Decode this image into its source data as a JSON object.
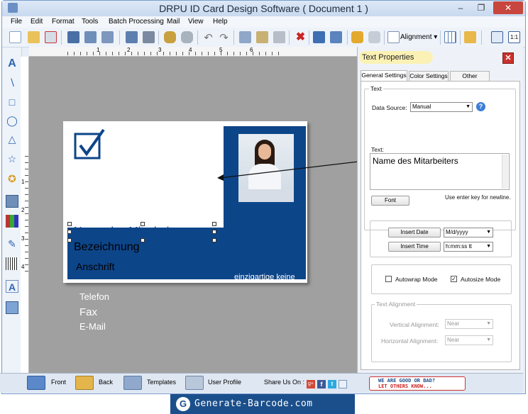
{
  "window": {
    "title": "DRPU ID Card Design Software ( Document 1 )"
  },
  "menu": [
    "File",
    "Edit",
    "Format",
    "Tools",
    "Batch Processing",
    "Mail",
    "View",
    "Help"
  ],
  "toolbar": {
    "alignment_label": "Alignment"
  },
  "ruler": {
    "marks": [
      "1",
      "2",
      "3",
      "4",
      "5",
      "6"
    ],
    "vmarks": [
      "1",
      "2",
      "3",
      "4"
    ]
  },
  "card": {
    "name": "Name des Mitarbeiters",
    "designation": "Bezeichnung",
    "address": "Anschrift",
    "phone": "Telefon",
    "fax": "Fax",
    "email": "E-Mail",
    "tagline": "einzigartige keine"
  },
  "panel": {
    "title": "Text Properties",
    "tabs": [
      "General Settings",
      "Color Settings",
      "Other Settings"
    ],
    "section_text": "Text",
    "data_source_label": "Data Source:",
    "data_source_value": "Manual",
    "text_label": "Text:",
    "text_value": "Name des Mitarbeiters",
    "font_button": "Font",
    "newline_hint": "Use enter key for newline.",
    "insert_date_button": "Insert Date",
    "insert_time_button": "Insert Time",
    "date_format": "M/d/yyyy",
    "time_format": "h:mm:ss tt",
    "autowrap_label": "Autowrap Mode",
    "autosize_label": "Autosize Mode",
    "alignment_group": "Text Alignment",
    "vertical_label": "Vertical Alignment:",
    "vertical_value": "Near",
    "horizontal_label": "Horizontal  Alignment:",
    "horizontal_value": "Near"
  },
  "statusbar": {
    "front": "Front",
    "back": "Back",
    "templates": "Templates",
    "user_profile": "User Profile",
    "share": "Share Us On :",
    "feedback_line1": "WE ARE GOOD OR BAD?",
    "feedback_line2": "LET OTHERS KNOW..."
  },
  "brand": {
    "text": "Generate-Barcode.com"
  },
  "colors": {
    "card_blue": "#0d4589",
    "accent": "#1b4f8c"
  }
}
